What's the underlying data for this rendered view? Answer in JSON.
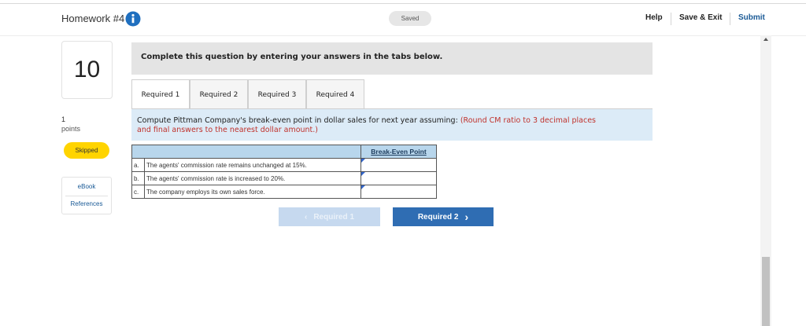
{
  "header": {
    "title": "Homework #4",
    "saved": "Saved",
    "help": "Help",
    "save_exit": "Save & Exit",
    "submit": "Submit"
  },
  "sidebar": {
    "question_number": "10",
    "points_value": "1",
    "points_label": "points",
    "status": "Skipped",
    "links": [
      "eBook",
      "References"
    ]
  },
  "main": {
    "instruction": "Complete this question by entering your answers in the tabs below.",
    "tabs": [
      "Required 1",
      "Required 2",
      "Required 3",
      "Required 4"
    ],
    "active_tab": "Required 1",
    "question_text": "Compute Pittman Company's break-even point in dollar sales for next year assuming:",
    "question_hint_a": "(Round CM ratio to 3 decimal places",
    "question_hint_b": "and final answers to the nearest dollar amount.)",
    "table": {
      "column_header": "Break-Even Point",
      "rows": [
        {
          "letter": "a.",
          "description": "The agents' commission rate remains unchanged at 15%.",
          "value": ""
        },
        {
          "letter": "b.",
          "description": "The agents' commission rate is increased to 20%.",
          "value": ""
        },
        {
          "letter": "c.",
          "description": "The company employs its own sales force.",
          "value": ""
        }
      ]
    },
    "prev_button": "Required 1",
    "next_button": "Required 2"
  },
  "colors": {
    "accent": "#2f6db3",
    "skipped_badge": "#ffd400",
    "hint_red": "#c0312b",
    "question_bg": "#dcebf7"
  }
}
